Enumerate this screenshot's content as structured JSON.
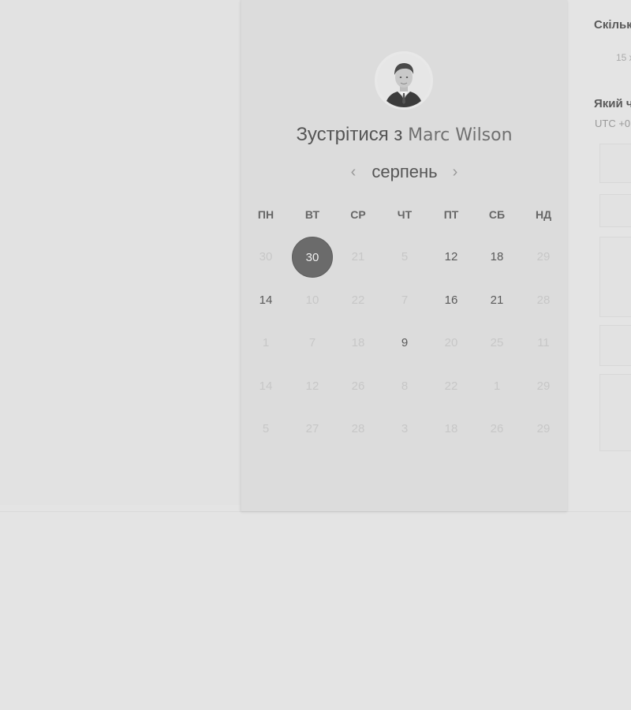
{
  "meeting": {
    "title_prefix": "Зустрітися з",
    "host_name": "Marc Wilson"
  },
  "calendar": {
    "month": "серпень",
    "prev_icon": "chevron-left-icon",
    "next_icon": "chevron-right-icon",
    "weekdays": [
      "ПН",
      "ВТ",
      "СР",
      "ЧТ",
      "ПТ",
      "СБ",
      "НД"
    ],
    "weeks": [
      [
        {
          "label": "30",
          "state": "faded"
        },
        {
          "label": "30",
          "state": "selected"
        },
        {
          "label": "21",
          "state": "faded"
        },
        {
          "label": "5",
          "state": "faded"
        },
        {
          "label": "12",
          "state": "available"
        },
        {
          "label": "18",
          "state": "available"
        },
        {
          "label": "29",
          "state": "faded"
        }
      ],
      [
        {
          "label": "14",
          "state": "available"
        },
        {
          "label": "10",
          "state": "faded"
        },
        {
          "label": "22",
          "state": "faded"
        },
        {
          "label": "7",
          "state": "faded"
        },
        {
          "label": "16",
          "state": "available"
        },
        {
          "label": "21",
          "state": "available"
        },
        {
          "label": "28",
          "state": "faded"
        }
      ],
      [
        {
          "label": "1",
          "state": "faded"
        },
        {
          "label": "7",
          "state": "faded"
        },
        {
          "label": "18",
          "state": "faded"
        },
        {
          "label": "9",
          "state": "available"
        },
        {
          "label": "20",
          "state": "faded"
        },
        {
          "label": "25",
          "state": "faded"
        },
        {
          "label": "11",
          "state": "faded"
        }
      ],
      [
        {
          "label": "14",
          "state": "faded"
        },
        {
          "label": "12",
          "state": "faded"
        },
        {
          "label": "26",
          "state": "faded"
        },
        {
          "label": "8",
          "state": "faded"
        },
        {
          "label": "22",
          "state": "faded"
        },
        {
          "label": "1",
          "state": "faded"
        },
        {
          "label": "29",
          "state": "faded"
        }
      ],
      [
        {
          "label": "5",
          "state": "faded"
        },
        {
          "label": "27",
          "state": "faded"
        },
        {
          "label": "28",
          "state": "faded"
        },
        {
          "label": "3",
          "state": "faded"
        },
        {
          "label": "18",
          "state": "faded"
        },
        {
          "label": "26",
          "state": "faded"
        },
        {
          "label": "29",
          "state": "faded"
        }
      ]
    ]
  },
  "right_panel": {
    "duration_heading": "Скільк",
    "duration_option": "15 х",
    "timezone_heading": "Який ч",
    "timezone_value": "UTC +0"
  },
  "colors": {
    "selected_day": "#6b6b6b",
    "available_day_text": "#5a5a5a",
    "faded_day_text": "#c7c7c7",
    "card_background": "#dcdcdc"
  }
}
